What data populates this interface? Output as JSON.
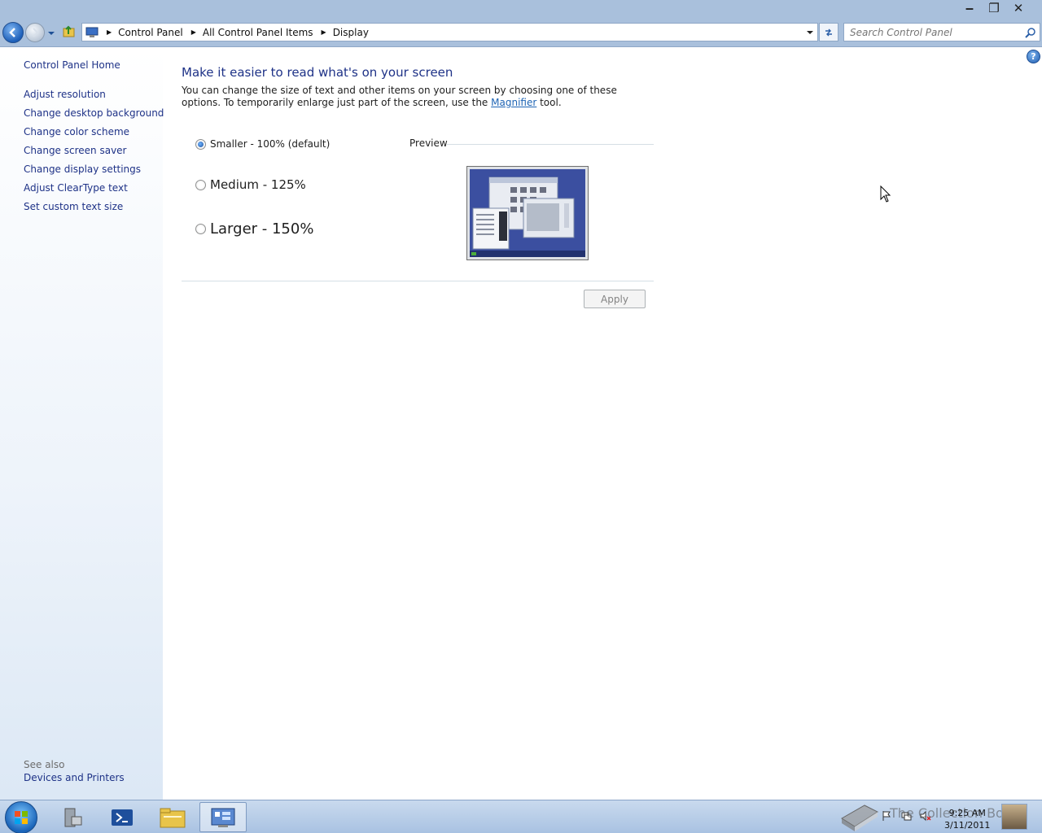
{
  "window": {
    "controls": {
      "minimize": "‒",
      "maximize": "❐",
      "close": "✕"
    }
  },
  "address": {
    "crumbs": [
      "Control Panel",
      "All Control Panel Items",
      "Display"
    ],
    "search_placeholder": "Search Control Panel"
  },
  "left_pane": {
    "home": "Control Panel Home",
    "links": [
      "Adjust resolution",
      "Change desktop background",
      "Change color scheme",
      "Change screen saver",
      "Change display settings",
      "Adjust ClearType text",
      "Set custom text size"
    ],
    "see_also_heading": "See also",
    "see_also_links": [
      "Devices and Printers"
    ]
  },
  "content": {
    "title": "Make it easier to read what's on your screen",
    "description_part1": "You can change the size of text and other items on your screen by choosing one of these options. To temporarily enlarge just part of the screen, use the ",
    "magnifier_link": "Magnifier",
    "description_part2": " tool.",
    "options": [
      {
        "label": "Smaller - 100% (default)",
        "selected": true
      },
      {
        "label": "Medium - 125%",
        "selected": false
      },
      {
        "label": "Larger - 150%",
        "selected": false
      }
    ],
    "preview_label": "Preview",
    "apply_label": "Apply"
  },
  "taskbar": {
    "time": "9:25 AM",
    "date": "3/11/2011",
    "watermark": "The Collection Book"
  },
  "colors": {
    "link": "#1e3287",
    "title_bar": "#a9c0dc",
    "accent_blue": "#1e64b4"
  }
}
